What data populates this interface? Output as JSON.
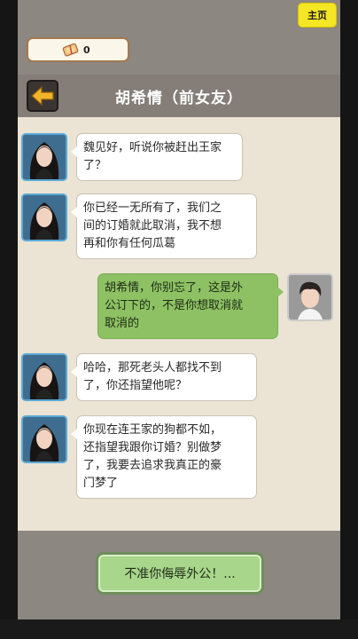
{
  "home_button": {
    "label": "主页"
  },
  "currency": {
    "icon": "ticket-icon",
    "value": "0"
  },
  "header": {
    "title": "胡希情（前女友）",
    "back_icon": "arrow-left-icon"
  },
  "messages": [
    {
      "sender": "girl",
      "text_lines": [
        "魏见好，听说你被赶出王家",
        "了？"
      ]
    },
    {
      "sender": "girl",
      "text_lines": [
        "你已经一无所有了，我们之",
        "间的订婚就此取消，我不想",
        "再和你有任何瓜葛"
      ]
    },
    {
      "sender": "player",
      "text_lines": [
        "胡希情，你别忘了，这是外",
        "公订下的，不是你想取消就",
        "取消的"
      ]
    },
    {
      "sender": "girl",
      "text_lines": [
        "哈哈，那死老头人都找不到",
        "了，你还指望他呢？"
      ]
    },
    {
      "sender": "girl",
      "text_lines": [
        "你现在连王家的狗都不如，",
        "还指望我跟你订婚？别做梦",
        "了，我要去追求我真正的豪",
        "门梦了"
      ]
    }
  ],
  "action_button": {
    "label": "不准你侮辱外公！..."
  },
  "colors": {
    "accent_yellow": "#f5e625",
    "player_bubble": "#8dc163",
    "action_green": "#a8d68b"
  }
}
